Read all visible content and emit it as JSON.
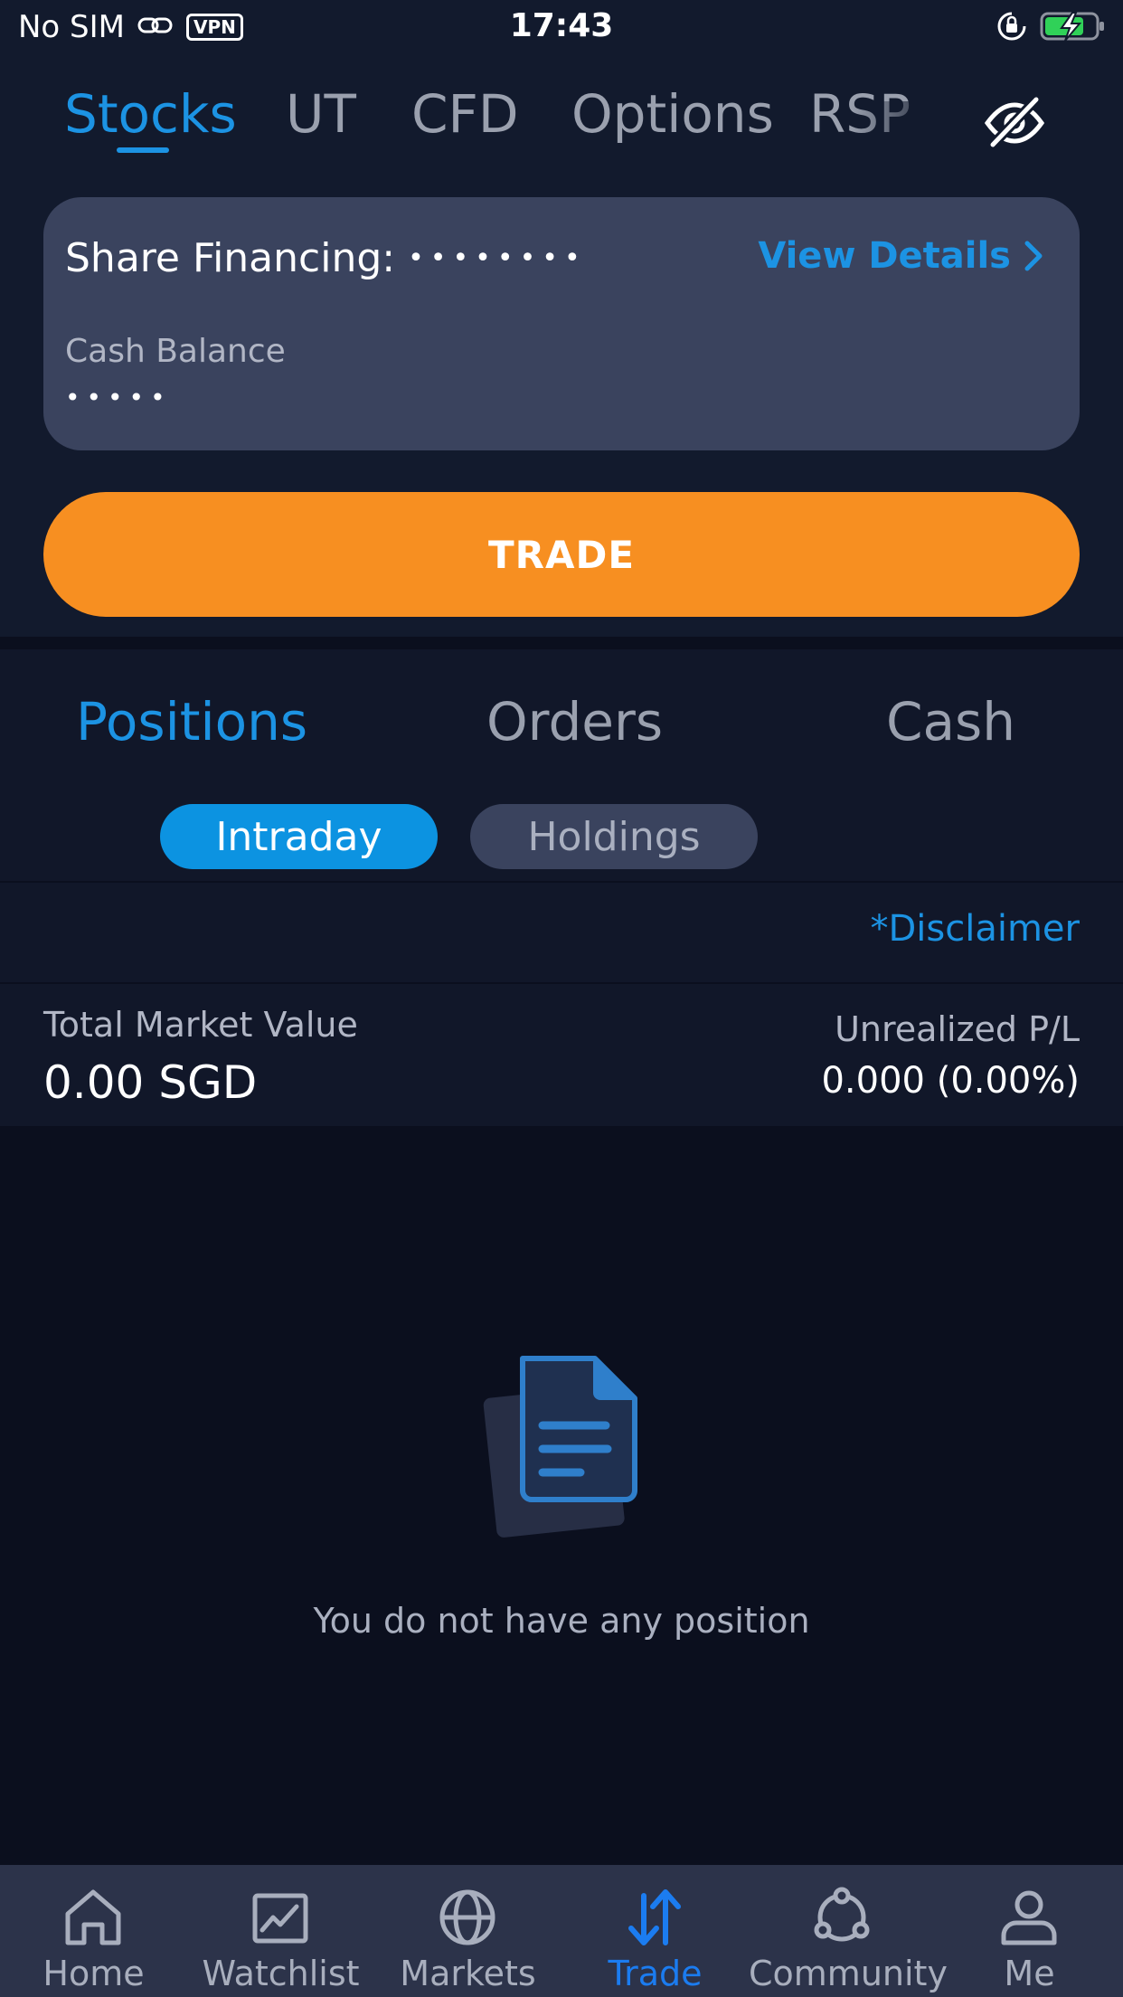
{
  "status_bar": {
    "carrier": "No SIM",
    "vpn": "VPN",
    "time": "17:43"
  },
  "asset_tabs": [
    {
      "label": "Stocks",
      "active": true
    },
    {
      "label": "UT",
      "active": false
    },
    {
      "label": "CFD",
      "active": false
    },
    {
      "label": "Options",
      "active": false
    },
    {
      "label": "RSP",
      "active": false
    }
  ],
  "account": {
    "share_financing_label": "Share Financing:",
    "share_financing_mask": "••••••••",
    "view_details_label": "View Details",
    "cash_balance_label": "Cash Balance",
    "cash_balance_mask": "•••••"
  },
  "trade_button_label": "TRADE",
  "sub_tabs": [
    {
      "label": "Positions",
      "active": true
    },
    {
      "label": "Orders",
      "active": false
    },
    {
      "label": "Cash",
      "active": false
    }
  ],
  "toggle": {
    "intraday": "Intraday",
    "holdings": "Holdings",
    "selected": "Intraday"
  },
  "disclaimer": "*Disclaimer",
  "summary": {
    "total_market_value_label": "Total Market Value",
    "total_market_value": "0.00 SGD",
    "unrealized_pl_label": "Unrealized P/L",
    "unrealized_pl_value": "0.000 (0.00%)"
  },
  "empty_state": {
    "message": "You do not have any position",
    "icon": "document-icon"
  },
  "bottom_nav": [
    {
      "label": "Home",
      "icon": "home-icon",
      "active": false
    },
    {
      "label": "Watchlist",
      "icon": "chart-icon",
      "active": false
    },
    {
      "label": "Markets",
      "icon": "globe-icon",
      "active": false
    },
    {
      "label": "Trade",
      "icon": "trade-arrows-icon",
      "active": true
    },
    {
      "label": "Community",
      "icon": "community-icon",
      "active": false
    },
    {
      "label": "Me",
      "icon": "person-icon",
      "active": false
    }
  ],
  "colors": {
    "accent": "#1c93e3",
    "trade_orange": "#f78f21",
    "background": "#0b0f1e",
    "card": "#3a435e"
  }
}
